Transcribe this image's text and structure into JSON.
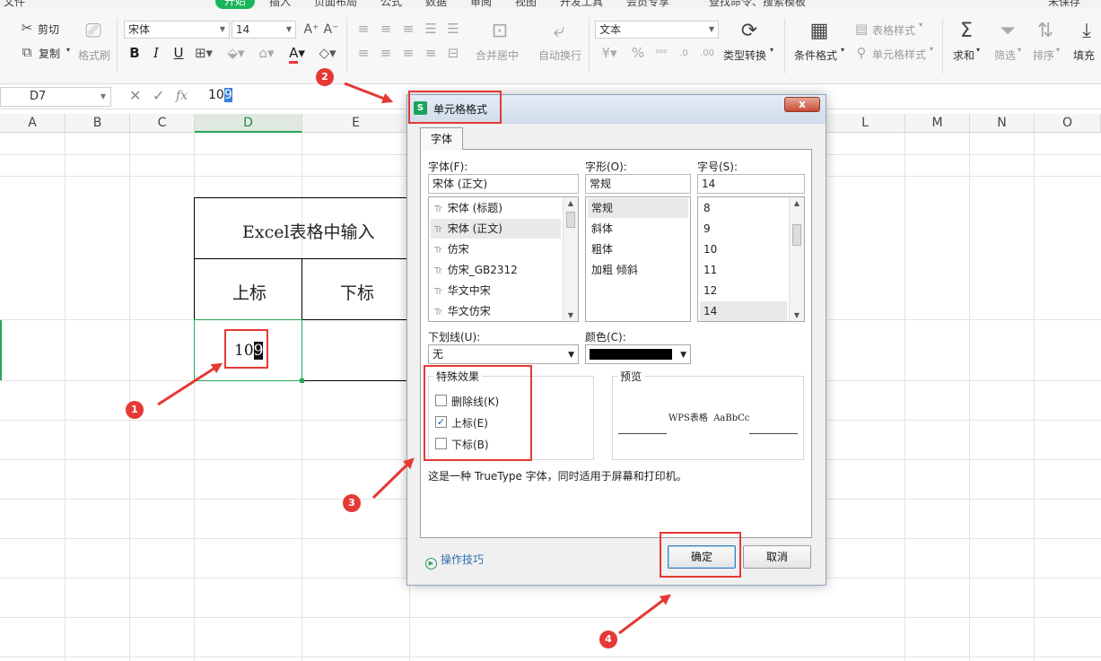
{
  "menubar": {
    "items": [
      "文件",
      "开始",
      "插入",
      "页面布局",
      "公式",
      "数据",
      "审阅",
      "视图",
      "开发工具",
      "会员专享"
    ],
    "search": "查找命令、搜索模板",
    "user": "未保存"
  },
  "ribbon": {
    "cut": "剪切",
    "copy": "复制",
    "format_painter": "格式刷",
    "font_name": "宋体",
    "font_size": "14",
    "merge_center": "合并居中",
    "wrap_text": "自动换行",
    "number_format": "文本",
    "type_convert": "类型转换",
    "cond_format": "条件格式",
    "table_style": "表格样式",
    "cell_style": "单元格样式",
    "sum": "求和",
    "filter": "筛选",
    "sort": "排序",
    "fill": "填充"
  },
  "formula_bar": {
    "cell_ref": "D7",
    "value_plain": "10",
    "value_selected": "9"
  },
  "grid": {
    "columns": [
      "A",
      "B",
      "C",
      "D",
      "E",
      "L",
      "M",
      "N",
      "O"
    ],
    "active_column": "D",
    "table_title": "Excel表格中输入",
    "header_sup": "上标",
    "header_sub": "下标",
    "cell_plain": "10",
    "cell_selected": "9"
  },
  "dialog": {
    "title": "单元格格式",
    "close": "x",
    "tab": "字体",
    "font_label": "字体(F):",
    "font_value": "宋体 (正文)",
    "font_list": [
      "宋体 (标题)",
      "宋体 (正文)",
      "仿宋",
      "仿宋_GB2312",
      "华文中宋",
      "华文仿宋"
    ],
    "font_selected_index": 1,
    "style_label": "字形(O):",
    "style_value": "常规",
    "style_list": [
      "常规",
      "斜体",
      "粗体",
      "加粗 倾斜"
    ],
    "size_label": "字号(S):",
    "size_value": "14",
    "size_list": [
      "8",
      "9",
      "10",
      "11",
      "12",
      "14"
    ],
    "underline_label": "下划线(U):",
    "underline_value": "无",
    "color_label": "颜色(C):",
    "color_value": "#000000",
    "effects_label": "特殊效果",
    "strikethrough_label": "删除线(K)",
    "superscript_label": "上标(E)",
    "subscript_label": "下标(B)",
    "strikethrough_checked": false,
    "superscript_checked": true,
    "subscript_checked": false,
    "preview_label": "预览",
    "preview_text": "WPS表格  AaBbCc",
    "info": "这是一种 TrueType 字体，同时适用于屏幕和打印机。",
    "tips": "操作技巧",
    "ok": "确定",
    "cancel": "取消"
  },
  "annotations": {
    "steps": [
      "1",
      "2",
      "3",
      "4"
    ],
    "color": "#e53935"
  },
  "colors": {
    "accent_green": "#19b55a",
    "selection_blue": "#3a7fd8"
  }
}
